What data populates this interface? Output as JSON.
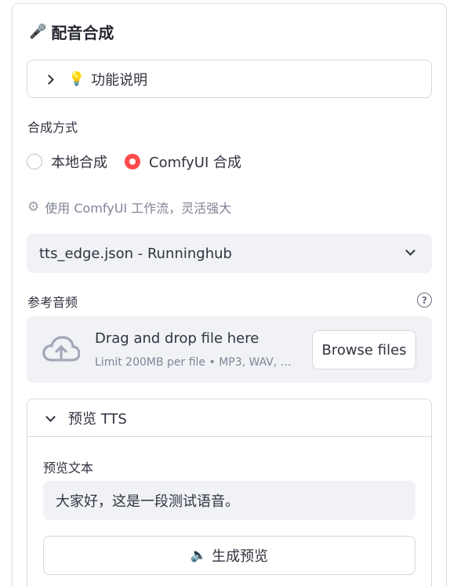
{
  "header": {
    "title": "配音合成",
    "icon": "microphone-icon"
  },
  "help_expander": {
    "label": "功能说明",
    "icon": "lightbulb-icon",
    "expanded": false
  },
  "synthesis_mode": {
    "label": "合成方式",
    "options": [
      {
        "label": "本地合成",
        "selected": false
      },
      {
        "label": "ComfyUI 合成",
        "selected": true
      }
    ],
    "accent_color": "#ff4b4b"
  },
  "caption": {
    "text": "使用 ComfyUI 工作流，灵活强大",
    "icon": "gear-icon"
  },
  "workflow_select": {
    "value": "tts_edge.json - Runninghub"
  },
  "reference_audio": {
    "label": "参考音频",
    "help_icon": "question-circle-icon",
    "drop_title": "Drag and drop file here",
    "drop_limit": "Limit 200MB per file • MP3, WAV, …",
    "browse_label": "Browse files",
    "upload_icon": "cloud-upload-icon"
  },
  "preview": {
    "header": "预览 TTS",
    "expanded": true,
    "text_label": "预览文本",
    "text_value": "大家好，这是一段测试语音。",
    "button_label": "生成预览",
    "button_icon": "speaker-icon"
  }
}
